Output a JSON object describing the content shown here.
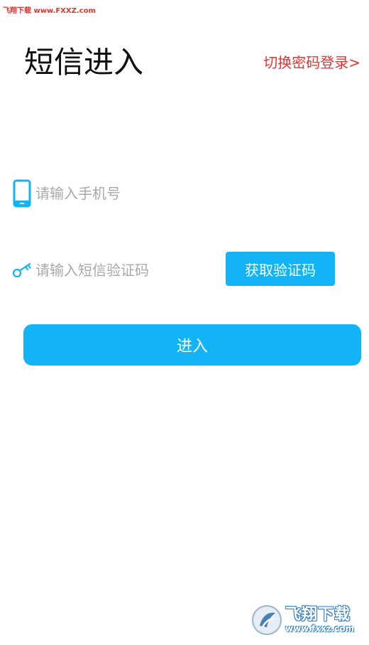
{
  "watermark": {
    "top_text": "飞翔下载 www.FXXZ.com",
    "logo_cn": "飞翔下载",
    "logo_en": "www.fxxz.com"
  },
  "header": {
    "title": "短信进入",
    "switch_link": "切换密码登录>"
  },
  "form": {
    "phone_placeholder": "请输入手机号",
    "code_placeholder": "请输入短信验证码",
    "get_code_label": "获取验证码",
    "submit_label": "进入"
  },
  "icons": {
    "phone": "phone-icon",
    "key": "key-icon"
  },
  "colors": {
    "accent": "#12b4f5",
    "link": "#e8332f",
    "placeholder": "#a9a9a9",
    "icon": "#12b4f5"
  }
}
